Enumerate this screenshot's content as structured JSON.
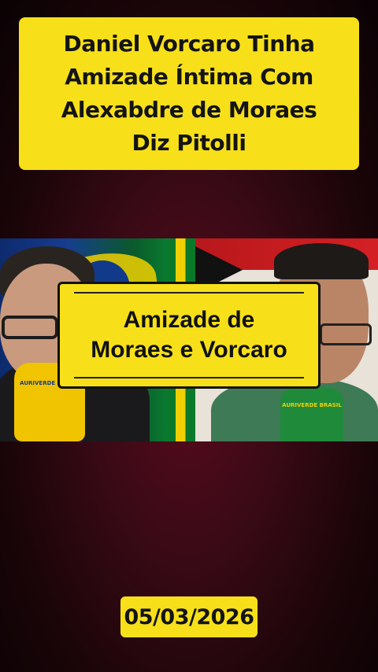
{
  "title": {
    "lines": [
      "Daniel Vorcaro Tinha",
      "Amizade Íntima Com",
      "Alexabdre de Moraes",
      "Diz Pitolli"
    ]
  },
  "overlay": {
    "lines": [
      "Amizade de",
      "Moraes e Vorcaro"
    ]
  },
  "video": {
    "mic_left_label": "AURIVERDE BRASIL",
    "mic_right_label": "AURIVERDE BRASIL"
  },
  "date": "05/03/2026",
  "colors": {
    "accent_yellow": "#f7e01a",
    "background_red": "#3a0a16",
    "text_dark": "#141414"
  }
}
